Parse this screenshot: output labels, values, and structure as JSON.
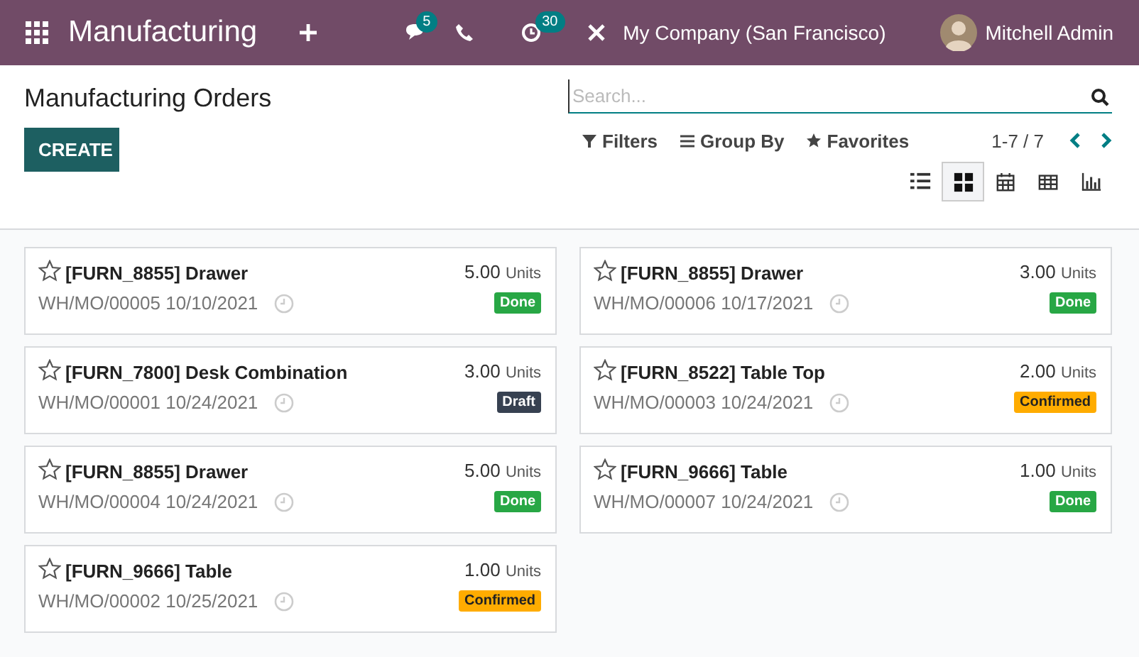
{
  "navbar": {
    "app_name": "Manufacturing",
    "messages_count": "5",
    "activities_count": "30",
    "company": "My Company (San Francisco)",
    "user": "Mitchell Admin"
  },
  "control_panel": {
    "title": "Manufacturing Orders",
    "create_button": "CREATE",
    "search": {
      "placeholder": "Search..."
    },
    "filters": [
      {
        "label": "Filters",
        "kind": "filter"
      },
      {
        "label": "Group By",
        "kind": "group"
      },
      {
        "label": "Favorites",
        "kind": "favorite"
      }
    ],
    "pager": "1-7 / 7",
    "views": [
      {
        "kind": "list",
        "selected": false
      },
      {
        "kind": "kanban",
        "selected": true
      },
      {
        "kind": "calendar",
        "selected": false
      },
      {
        "kind": "pivot",
        "selected": false
      },
      {
        "kind": "graph",
        "selected": false
      }
    ]
  },
  "cards": [
    {
      "product": "[FURN_8855] Drawer",
      "quantity": "5.00",
      "unit": "Units",
      "reference": "WH/MO/00005",
      "date": "10/10/2021",
      "starred": false,
      "status": {
        "label": "Done",
        "color": "#28a745"
      }
    },
    {
      "product": "[FURN_8855] Drawer",
      "quantity": "3.00",
      "unit": "Units",
      "reference": "WH/MO/00006",
      "date": "10/17/2021",
      "starred": false,
      "status": {
        "label": "Done",
        "color": "#28a745"
      }
    },
    {
      "product": "[FURN_7800] Desk Combination",
      "quantity": "3.00",
      "unit": "Units",
      "reference": "WH/MO/00001",
      "date": "10/24/2021",
      "starred": false,
      "status": {
        "label": "Draft",
        "color": "#374151"
      }
    },
    {
      "product": "[FURN_8522] Table Top",
      "quantity": "2.00",
      "unit": "Units",
      "reference": "WH/MO/00003",
      "date": "10/24/2021",
      "starred": false,
      "status": {
        "label": "Confirmed",
        "color": "#ffac00"
      }
    },
    {
      "product": "[FURN_8855] Drawer",
      "quantity": "5.00",
      "unit": "Units",
      "reference": "WH/MO/00004",
      "date": "10/24/2021",
      "starred": false,
      "status": {
        "label": "Done",
        "color": "#28a745"
      }
    },
    {
      "product": "[FURN_9666] Table",
      "quantity": "1.00",
      "unit": "Units",
      "reference": "WH/MO/00007",
      "date": "10/24/2021",
      "starred": false,
      "status": {
        "label": "Done",
        "color": "#28a745"
      }
    },
    {
      "product": "[FURN_9666] Table",
      "quantity": "1.00",
      "unit": "Units",
      "reference": "WH/MO/00002",
      "date": "10/25/2021",
      "starred": false,
      "status": {
        "label": "Confirmed",
        "color": "#ffac00"
      }
    }
  ]
}
